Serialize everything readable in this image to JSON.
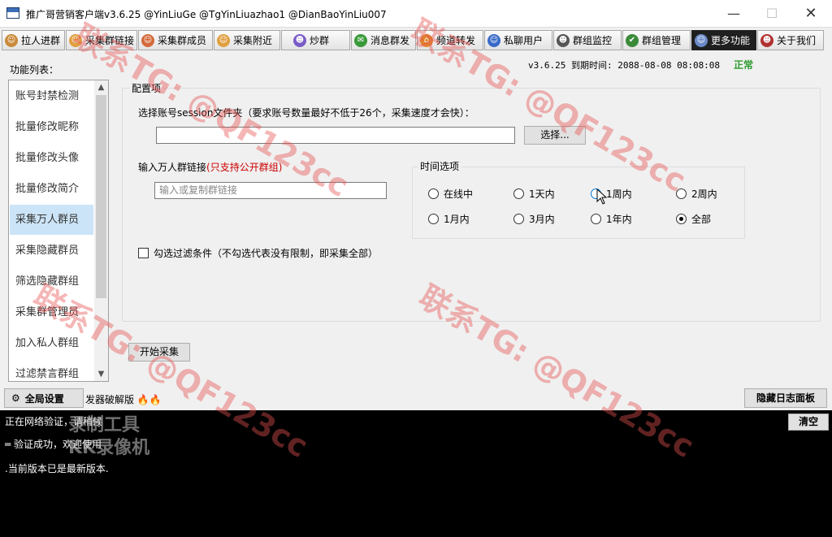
{
  "window": {
    "title": "推广哥营销客户端v3.6.25 @YinLiuGe @TgYinLiuazhao1 @DianBaoYinLiu007",
    "minimize": "—",
    "maximize": "☐",
    "close": "✕"
  },
  "tabs": [
    {
      "label": "拉人进群",
      "icon": "people-icon",
      "color": "#c98a3a"
    },
    {
      "label": "采集群链接",
      "icon": "face-icon",
      "color": "#e0a040"
    },
    {
      "label": "采集群成员",
      "icon": "face-icon",
      "color": "#d46a3a"
    },
    {
      "label": "采集附近",
      "icon": "face-icon",
      "color": "#e0a040"
    },
    {
      "label": "炒群",
      "icon": "group-icon",
      "color": "#7a5cc8"
    },
    {
      "label": "消息群发",
      "icon": "message-icon",
      "color": "#3a9a3a"
    },
    {
      "label": "频道转发",
      "icon": "channel-icon",
      "color": "#e08a2a"
    },
    {
      "label": "私聊用户",
      "icon": "user-icon",
      "color": "#3a6ac8"
    },
    {
      "label": "群组监控",
      "icon": "monitor-icon",
      "color": "#555555"
    },
    {
      "label": "群组管理",
      "icon": "manage-icon",
      "color": "#3a8a3a"
    },
    {
      "label": "更多功能",
      "icon": "more-icon",
      "color": "#6a8ac8"
    },
    {
      "label": "关于我们",
      "icon": "about-icon",
      "color": "#b23030"
    }
  ],
  "sidebar": {
    "title": "功能列表：",
    "items": [
      {
        "label": "账号封禁检测"
      },
      {
        "label": "批量修改昵称"
      },
      {
        "label": "批量修改头像"
      },
      {
        "label": "批量修改简介"
      },
      {
        "label": "采集万人群员"
      },
      {
        "label": "采集隐藏群员"
      },
      {
        "label": "筛选隐藏群组"
      },
      {
        "label": "采集群管理员"
      },
      {
        "label": "加入私人群组"
      },
      {
        "label": "过滤禁言群组"
      }
    ],
    "selected_index": 4
  },
  "status": {
    "version_line": "v3.6.25  到期时间: 2088-08-08 08:08:08",
    "state": "正常",
    "state_color": "#2e9b2e"
  },
  "config": {
    "legend": "配置项",
    "session_label": "选择账号session文件夹（要求账号数量最好不低于26个，采集速度才会快）：",
    "session_value": "",
    "choose_button": "选择...",
    "link_label": "输入万人群链接",
    "link_hint": "(只支持公开群组)",
    "link_placeholder": "输入或复制群链接",
    "time_legend": "时间选项",
    "time_options": [
      {
        "label": "在线中",
        "checked": false
      },
      {
        "label": "1天内",
        "checked": false
      },
      {
        "label": "1周内",
        "checked": false
      },
      {
        "label": "2周内",
        "checked": false
      },
      {
        "label": "1月内",
        "checked": false
      },
      {
        "label": "3月内",
        "checked": false
      },
      {
        "label": "1年内",
        "checked": false
      },
      {
        "label": "全部",
        "checked": true
      }
    ],
    "filter_label": "勾选过滤条件（不勾选代表没有限制，即采集全部）",
    "filter_checked": false,
    "start_button": "开始采集"
  },
  "bottom": {
    "global_settings": "全局设置",
    "crack_text": "发器破解版",
    "hide_log": "隐藏日志面板"
  },
  "log": {
    "clear_button": "清空",
    "lines": [
      "正在网络验证，请稍候",
      "═   验证成功，欢迎使用",
      ".当前版本已是最新版本."
    ],
    "recorder_watermark": [
      "录制工具",
      "KK录像机"
    ]
  },
  "watermark": {
    "text": "联系TG: @QF123cc"
  }
}
